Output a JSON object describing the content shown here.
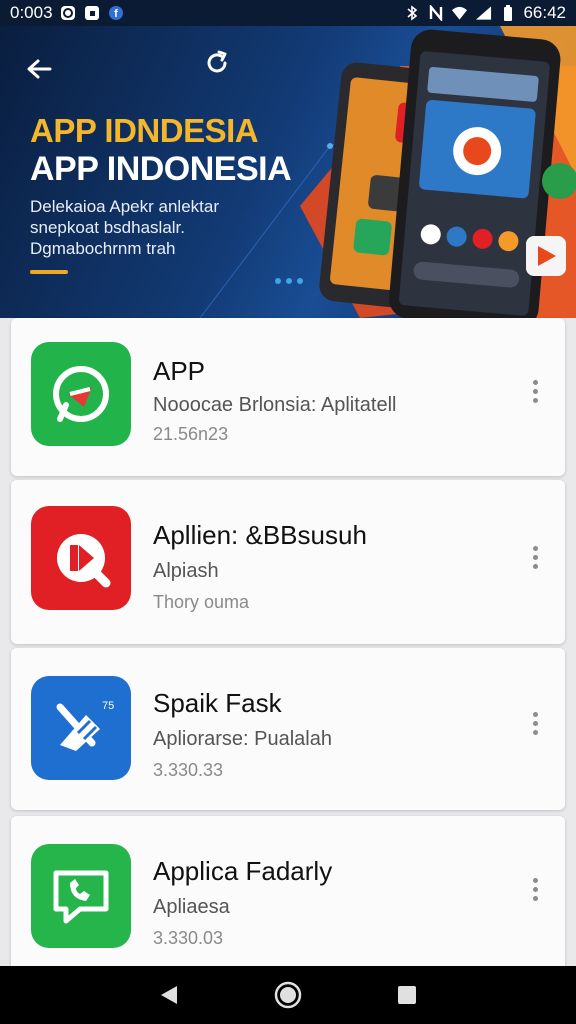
{
  "status_bar": {
    "time_left": "0:003",
    "time_right": "66:42",
    "icons": [
      "whatsapp-icon",
      "app-icon",
      "facebook-icon",
      "bluetooth-icon",
      "nfc-icon",
      "wifi-icon",
      "signal-icon",
      "battery-icon"
    ]
  },
  "hero": {
    "title_line1": "APP IDNDESIA",
    "title_line2": "APP INDONESIA",
    "description": "Delekaioa Apekr anlektar snepkoat bsdhaslalr. Dgmabochrnm trah",
    "colors": {
      "title_accent": "#f4b62a",
      "background": "#123a74",
      "orange": "#f15a24"
    }
  },
  "apps": [
    {
      "name": "APP",
      "subtitle": "Nooocae Brlonsia: Aplitatell",
      "meta": "21.56n23",
      "icon": "whatsapp-icon",
      "color": "#22b34a"
    },
    {
      "name": "Apllien: &BBsusuh",
      "subtitle": "Alpiash",
      "meta": "Thory ouma",
      "icon": "play-q-icon",
      "color": "#e02024"
    },
    {
      "name": "Spaik Fask",
      "subtitle": "Apliorarse: Pualalah",
      "meta": "3.330.33",
      "icon": "broom-icon",
      "color": "#1e6fd0"
    },
    {
      "name": "Applica Fadarly",
      "subtitle": "Apliaesa",
      "meta": "3.330.03",
      "icon": "chat-phone-icon",
      "color": "#26b54a"
    }
  ],
  "nav": {
    "icons": [
      "back-triangle-icon",
      "home-circle-icon",
      "recents-square-icon"
    ]
  }
}
